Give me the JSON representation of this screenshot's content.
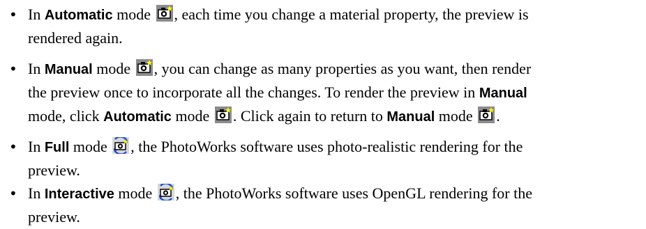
{
  "bullets": [
    {
      "line1_a": "In ",
      "ui1": "Automatic",
      "line1_b": " mode",
      "line1_c": ", each time you change a material property, the preview is",
      "line2": "rendered again."
    },
    {
      "line1_a": "In ",
      "ui1": "Manual",
      "line1_b": " mode",
      "line1_c": ", you can change as many properties as you want, then render",
      "line2_a": "the preview once to incorporate all the changes. To render the preview in ",
      "ui2": "Manual",
      "line3_a": "mode, click ",
      "ui3": "Automatic",
      "line3_b": " mode",
      "line3_c": ". Click again to return to ",
      "ui4": "Manual",
      "line3_d": " mode",
      "line3_e": "."
    },
    {
      "line1_a": "In ",
      "ui1": "Full",
      "line1_b": " mode",
      "line1_c": ", the PhotoWorks software uses photo-realistic rendering for the",
      "line2": "preview."
    },
    {
      "line1_a": "In ",
      "ui1": "Interactive",
      "line1_b": " mode",
      "line1_c": ", the PhotoWorks software uses OpenGL rendering for the",
      "line2": "preview."
    }
  ],
  "icons": {
    "camera": "camera-icon",
    "camera_refresh": "camera-refresh-icon"
  },
  "colors": {
    "icon_bg": "#8c8c8c",
    "icon_star": "#ffff00",
    "refresh_blue": "#1f4fd8"
  }
}
